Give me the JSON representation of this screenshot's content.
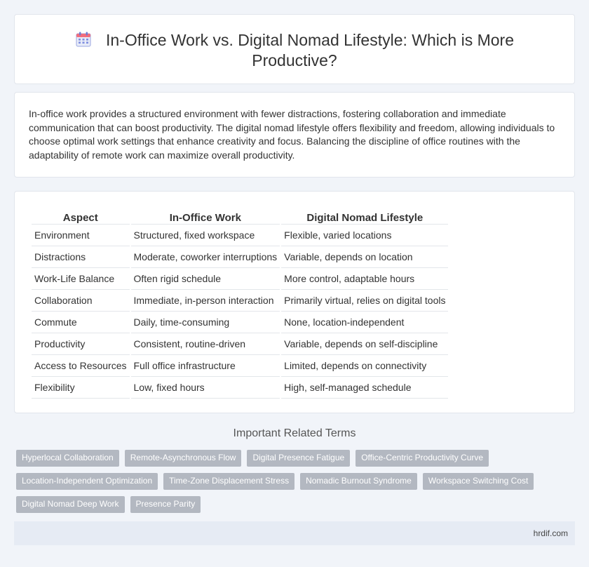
{
  "header": {
    "title": "In-Office Work vs. Digital Nomad Lifestyle: Which is More Productive?",
    "icon": "calendar-icon"
  },
  "summary": "In-office work provides a structured environment with fewer distractions, fostering collaboration and immediate communication that can boost productivity. The digital nomad lifestyle offers flexibility and freedom, allowing individuals to choose optimal work settings that enhance creativity and focus. Balancing the discipline of office routines with the adaptability of remote work can maximize overall productivity.",
  "table": {
    "headers": [
      "Aspect",
      "In-Office Work",
      "Digital Nomad Lifestyle"
    ],
    "rows": [
      [
        "Environment",
        "Structured, fixed workspace",
        "Flexible, varied locations"
      ],
      [
        "Distractions",
        "Moderate, coworker interruptions",
        "Variable, depends on location"
      ],
      [
        "Work-Life Balance",
        "Often rigid schedule",
        "More control, adaptable hours"
      ],
      [
        "Collaboration",
        "Immediate, in-person interaction",
        "Primarily virtual, relies on digital tools"
      ],
      [
        "Commute",
        "Daily, time-consuming",
        "None, location-independent"
      ],
      [
        "Productivity",
        "Consistent, routine-driven",
        "Variable, depends on self-discipline"
      ],
      [
        "Access to Resources",
        "Full office infrastructure",
        "Limited, depends on connectivity"
      ],
      [
        "Flexibility",
        "Low, fixed hours",
        "High, self-managed schedule"
      ]
    ]
  },
  "related": {
    "heading": "Important Related Terms",
    "terms": [
      "Hyperlocal Collaboration",
      "Remote-Asynchronous Flow",
      "Digital Presence Fatigue",
      "Office-Centric Productivity Curve",
      "Location-Independent Optimization",
      "Time-Zone Displacement Stress",
      "Nomadic Burnout Syndrome",
      "Workspace Switching Cost",
      "Digital Nomad Deep Work",
      "Presence Parity"
    ]
  },
  "footer": {
    "site": "hrdif.com"
  },
  "colors": {
    "background": "#f1f4f9",
    "tag": "#b3b8c1",
    "footer": "#e6ebf4"
  }
}
